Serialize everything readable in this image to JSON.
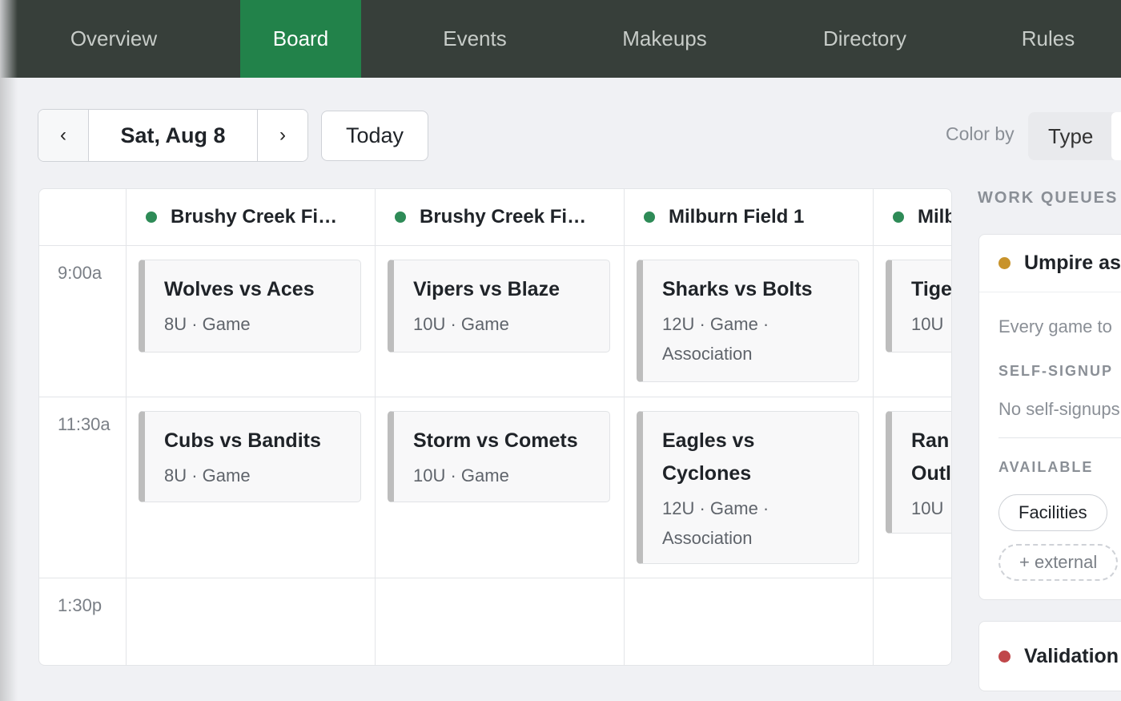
{
  "nav": {
    "tabs": [
      {
        "label": "Overview"
      },
      {
        "label": "Board"
      },
      {
        "label": "Events"
      },
      {
        "label": "Makeups"
      },
      {
        "label": "Directory"
      },
      {
        "label": "Rules"
      }
    ],
    "active": "Board"
  },
  "toolbar": {
    "prev_icon": "‹",
    "next_icon": "›",
    "date": "Sat, Aug 8",
    "today_label": "Today",
    "color_by_label": "Color by",
    "color_by_value": "Type"
  },
  "board": {
    "columns": [
      {
        "name": "Brushy Creek Fi…",
        "status_color": "#2e8b57"
      },
      {
        "name": "Brushy Creek Fi…",
        "status_color": "#2e8b57"
      },
      {
        "name": "Milburn Field 1",
        "status_color": "#2e8b57"
      },
      {
        "name": "Milb",
        "status_color": "#2e8b57"
      }
    ],
    "times": [
      "9:00a",
      "11:30a",
      "1:30p"
    ],
    "slots": [
      [
        {
          "title": "Wolves vs Aces",
          "meta": "8U · Game"
        },
        {
          "title": "Vipers vs Blaze",
          "meta": "10U · Game"
        },
        {
          "title": "Sharks vs Bolts",
          "meta": "12U · Game · Association"
        },
        {
          "title": "Tige",
          "meta": "10U"
        }
      ],
      [
        {
          "title": "Cubs vs Bandits",
          "meta": "8U · Game"
        },
        {
          "title": "Storm vs Comets",
          "meta": "10U · Game"
        },
        {
          "title": "Eagles vs Cyclones",
          "meta": "12U · Game · Association"
        },
        {
          "title": "Ran\nOutl",
          "meta": "10U"
        }
      ]
    ]
  },
  "work_queues": {
    "title": "WORK QUEUES",
    "umpire": {
      "title": "Umpire as",
      "dot_color": "#c8932b",
      "description": "Every game to",
      "self_signup_label": "SELF-SIGNUP",
      "self_signup_text": "No self-signups",
      "available_label": "AVAILABLE",
      "chips": [
        "Facilities"
      ],
      "external_label": "+ external"
    },
    "validation": {
      "title": "Validation",
      "dot_color": "#c0474a"
    }
  }
}
